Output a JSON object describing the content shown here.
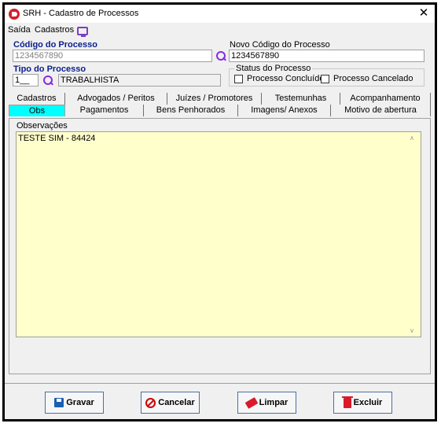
{
  "window": {
    "title": "SRH - Cadastro de Processos",
    "close_glyph": "✕"
  },
  "menu": {
    "items": [
      "Saída",
      "Cadastros"
    ],
    "icon": "monitor-icon"
  },
  "form": {
    "codigo_label": "Código do Processo",
    "codigo_value": "1234567890",
    "novo_codigo_label": "Novo Código do Processo",
    "novo_codigo_value": "1234567890",
    "tipo_label": "Tipo do Processo",
    "tipo_code": "1__",
    "tipo_desc": "TRABALHISTA",
    "status_label": "Status do Processo",
    "status_concluido": "Processo Concluído",
    "status_cancelado": "Processo Cancelado"
  },
  "tabs_row1": [
    {
      "label": "Cadastros"
    },
    {
      "label": "Advogados / Peritos"
    },
    {
      "label": "Juízes / Promotores"
    },
    {
      "label": "Testemunhas"
    },
    {
      "label": "Acompanhamento"
    }
  ],
  "tabs_row2": [
    {
      "label": "Obs",
      "active": true
    },
    {
      "label": "Pagamentos"
    },
    {
      "label": "Bens Penhorados"
    },
    {
      "label": "Imagens/ Anexos"
    },
    {
      "label": "Motivo de abertura"
    }
  ],
  "obs": {
    "label": "Observações",
    "text": "TESTE SIM - 84424"
  },
  "buttons": {
    "gravar": "Gravar",
    "cancelar": "Cancelar",
    "limpar": "Limpar",
    "excluir": "Excluir"
  },
  "colors": {
    "accent_tab": "#00ffff",
    "obs_bg": "#ffffcc",
    "label_blue": "#0a1e8c"
  }
}
